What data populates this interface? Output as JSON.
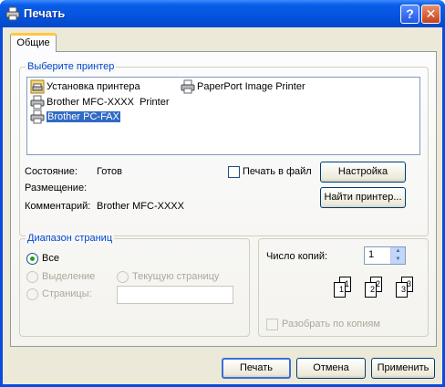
{
  "window": {
    "title": "Печать",
    "help_button": "?",
    "close_button": "✕"
  },
  "tabs": [
    {
      "label": "Общие",
      "selected": true
    }
  ],
  "printer_section": {
    "legend": "Выберите принтер",
    "printers": [
      {
        "name": "Установка принтера",
        "icon": "add-printer-icon",
        "selected": false
      },
      {
        "name": "Brother MFC-XXXX  Printer",
        "icon": "printer-icon",
        "selected": false
      },
      {
        "name": "Brother PC-FAX",
        "icon": "printer-icon",
        "selected": true
      },
      {
        "name": "PaperPort Image Printer",
        "icon": "printer-icon",
        "selected": false
      }
    ],
    "status_label": "Состояние:",
    "status_value": "Готов",
    "location_label": "Размещение:",
    "location_value": "",
    "comment_label": "Комментарий:",
    "comment_value": "Brother MFC-XXXX",
    "print_to_file_label": "Печать в файл",
    "print_to_file_checked": false,
    "preferences_button": "Настройка",
    "find_printer_button": "Найти принтер..."
  },
  "page_range": {
    "legend": "Диапазон страниц",
    "all_label": "Все",
    "selection_label": "Выделение",
    "current_page_label": "Текущую страницу",
    "pages_label": "Страницы:",
    "pages_value": "",
    "selected_option": "all"
  },
  "copies": {
    "label": "Число копий:",
    "value": "1",
    "collate_label": "Разобрать по копиям",
    "collate_checked": false,
    "collate_pages": [
      "1",
      "1",
      "2",
      "2",
      "3",
      "3"
    ]
  },
  "buttons": {
    "print": "Печать",
    "cancel": "Отмена",
    "apply": "Применить"
  },
  "colors": {
    "titlebar": "#0553e0",
    "dialog_bg": "#ece9d8",
    "group_legend": "#0046d5",
    "selection": "#316ac5"
  }
}
